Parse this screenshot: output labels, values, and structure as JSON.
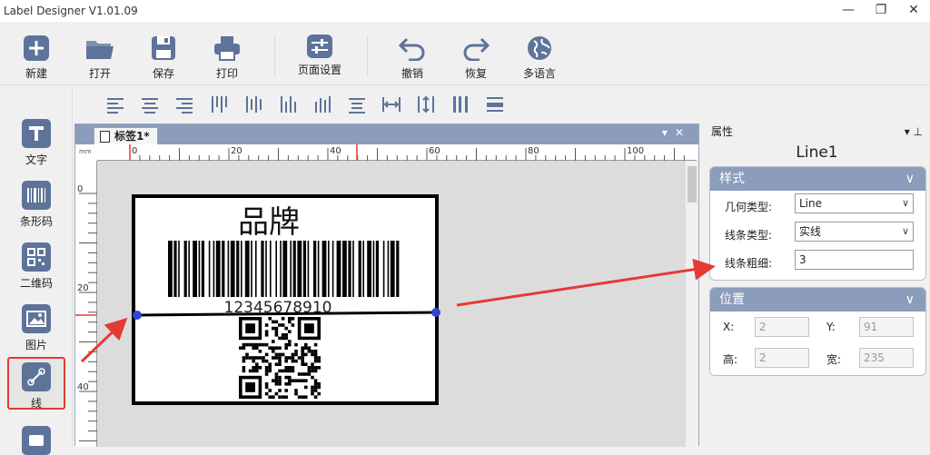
{
  "window": {
    "title": "Label Designer V1.01.09"
  },
  "toolbar": [
    {
      "label": "新建",
      "icon": "plus-icon"
    },
    {
      "label": "打开",
      "icon": "folder-icon"
    },
    {
      "label": "保存",
      "icon": "save-icon"
    },
    {
      "label": "打印",
      "icon": "printer-icon"
    },
    {
      "label": "页面设置",
      "icon": "page-settings-icon"
    },
    {
      "label": "撤销",
      "icon": "undo-icon"
    },
    {
      "label": "恢复",
      "icon": "redo-icon"
    },
    {
      "label": "多语言",
      "icon": "globe-icon"
    }
  ],
  "leftbar": [
    {
      "label": "文字",
      "icon": "text-icon"
    },
    {
      "label": "条形码",
      "icon": "barcode-icon"
    },
    {
      "label": "二维码",
      "icon": "qrcode-icon"
    },
    {
      "label": "图片",
      "icon": "image-icon"
    },
    {
      "label": "线",
      "icon": "line-icon",
      "active": true
    }
  ],
  "document": {
    "tab_label": "标签1*",
    "ruler_unit": "mm",
    "h_ticks": [
      "0",
      "20",
      "40",
      "60",
      "80",
      "100"
    ],
    "v_ticks": [
      "0",
      "20",
      "40"
    ]
  },
  "label": {
    "brand_text": "品牌",
    "barcode_number": "12345678910"
  },
  "properties": {
    "header": "属性",
    "object_name": "Line1",
    "style_group": {
      "title": "样式",
      "geometry_label": "几何类型:",
      "geometry_value": "Line",
      "line_type_label": "线条类型:",
      "line_type_value": "实线",
      "line_width_label": "线条粗细:",
      "line_width_value": "3"
    },
    "position_group": {
      "title": "位置",
      "x_label": "X:",
      "x_value": "2",
      "y_label": "Y:",
      "y_value": "91",
      "h_label": "高:",
      "h_value": "2",
      "w_label": "宽:",
      "w_value": "235"
    }
  },
  "colors": {
    "accent": "#8c9cbb",
    "icon_bg": "#5e7399",
    "annotation": "#e53935"
  }
}
